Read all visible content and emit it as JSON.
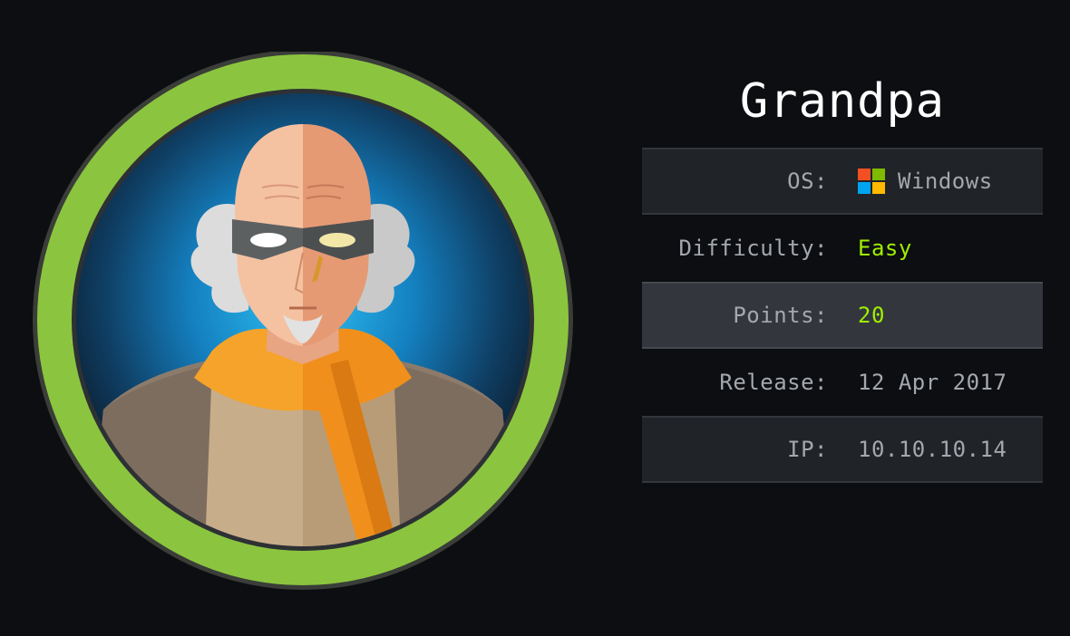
{
  "machine": {
    "name": "Grandpa"
  },
  "info": {
    "os_label": "OS:",
    "os_value": "Windows",
    "os_icon": "windows-logo-icon",
    "difficulty_label": "Difficulty:",
    "difficulty_value": "Easy",
    "points_label": "Points:",
    "points_value": "20",
    "release_label": "Release:",
    "release_value": "12 Apr 2017",
    "ip_label": "IP:",
    "ip_value": "10.10.10.14"
  },
  "colors": {
    "background": "#0c0e11",
    "accent": "#9fef00",
    "ring": "#8bc53f",
    "label": "#a4a8ad",
    "title": "#ffffff"
  },
  "avatar": {
    "icon": "grandpa-avatar-icon"
  }
}
